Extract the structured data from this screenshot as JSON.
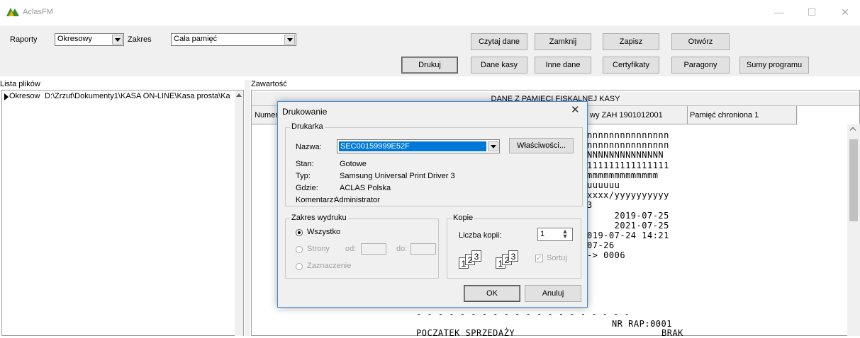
{
  "window": {
    "title": "AclasFM",
    "controls": {
      "minimize": "—",
      "maximize": "☐",
      "close": "✕"
    }
  },
  "toolbar": {
    "raporty_label": "Raporty",
    "raporty_value": "Okresowy",
    "zakres_label": "Zakres",
    "zakres_value": "Cała pamięć",
    "buttons": {
      "czytaj": "Czytaj dane",
      "zamknij": "Zamknij",
      "zapisz": "Zapisz",
      "otworz": "Otwórz",
      "drukuj": "Drukuj",
      "dane_kasy": "Dane kasy",
      "inne_dane": "Inne dane",
      "certyfikaty": "Certyfikaty",
      "paragony": "Paragony",
      "sumy": "Sumy programu"
    }
  },
  "left": {
    "header": "Lista plików",
    "row_name": "Okresow",
    "row_path": "D:\\Zrzut\\Dokumenty1\\KASA ON-LINE\\Kasa prosta\\Ka"
  },
  "right": {
    "header": "Zawartość",
    "banner": "DANE Z PAMIECI FISKALNEJ KASY",
    "col1": "Numer",
    "col2": "wy ZAH 1901012001",
    "col3": "Pamięć chroniona  1",
    "lines": [
      "nnnnnnnnnnnnnnn",
      "nnnnnnnnnnnnnnn",
      "NNNNNNNNNNNNNN",
      "",
      "111111111111111",
      "mmmmmmmmmmmmm",
      "uuuuuu",
      "xxxx/yyyyyyyyyy",
      "",
      "3",
      "",
      "",
      "     2019-07-25",
      "     2021-07-25",
      "019-07-24 14:21",
      "",
      "07-26",
      "-> 0006"
    ],
    "dashes": "- - - - - - - - - - - - - - - - - - - -",
    "nr_rap": "NR RAP:0001",
    "poczatek": "POCZATEK SPRZEDAŻY",
    "brak": "BRAK"
  },
  "dialog": {
    "title": "Drukowanie",
    "drukarka_group": "Drukarka",
    "nazwa_label": "Nazwa:",
    "nazwa_value": "SEC00159999E52F",
    "wlasciwosci": "Właściwości...",
    "stan_label": "Stan:",
    "stan_value": "Gotowe",
    "typ_label": "Typ:",
    "typ_value": "Samsung Universal Print Driver 3",
    "gdzie_label": "Gdzie:",
    "gdzie_value": "ACLAS Polska",
    "komentarz_label": "Komentarz:",
    "komentarz_value": "Administrator",
    "zakres_group": "Zakres wydruku",
    "wszystko": "Wszystko",
    "strony": "Strony",
    "od": "od:",
    "do": "do:",
    "zaznaczenie": "Zaznaczenie",
    "kopie_group": "Kopie",
    "liczba_kopii_label": "Liczba kopii:",
    "liczba_kopii_value": "1",
    "sortuj": "Sortuj",
    "ok": "OK",
    "anuluj": "Anuluj"
  }
}
